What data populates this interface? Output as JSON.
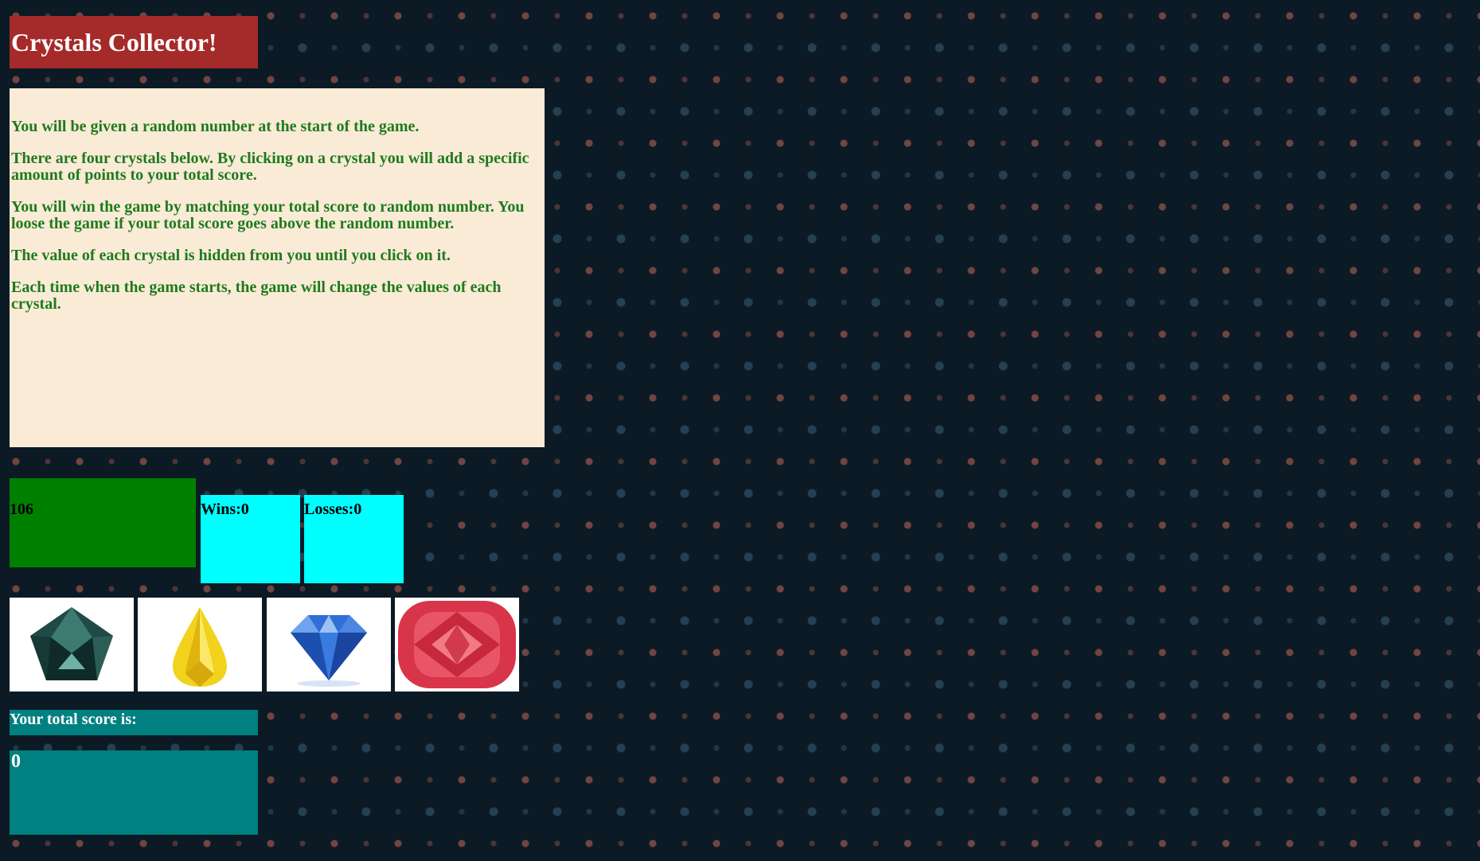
{
  "header": {
    "title": "Crystals Collector!"
  },
  "instructions": [
    "You will be given a random number at the start of the game.",
    "There are four crystals below. By clicking on a crystal you will add a specific amount of points to your total score.",
    "You will win the game by matching your total score to random number. You loose the game if your total score goes above the random number.",
    "The value of each crystal is hidden from you until you click on it.",
    "Each time when the game starts, the game will change the values of each crystal."
  ],
  "game": {
    "target_number": "106",
    "wins_text": "Wins:0",
    "losses_text": "Losses:0",
    "score_label": "Your total score is:",
    "score_value": "0"
  },
  "crystals": [
    {
      "icon": "teal-gem-icon",
      "color": "#2a5a55"
    },
    {
      "icon": "yellow-gem-icon",
      "color": "#f2d21c"
    },
    {
      "icon": "blue-gem-icon",
      "color": "#2f6fd6"
    },
    {
      "icon": "red-gem-icon",
      "color": "#d9354a"
    }
  ],
  "colors": {
    "title_bg": "#a52a2a",
    "instructions_bg": "#faebd7",
    "instructions_text": "#1e7b1e",
    "target_bg": "#008000",
    "stats_bg": "#00ffff",
    "score_bg": "#008080",
    "page_bg": "#0b1a24"
  }
}
